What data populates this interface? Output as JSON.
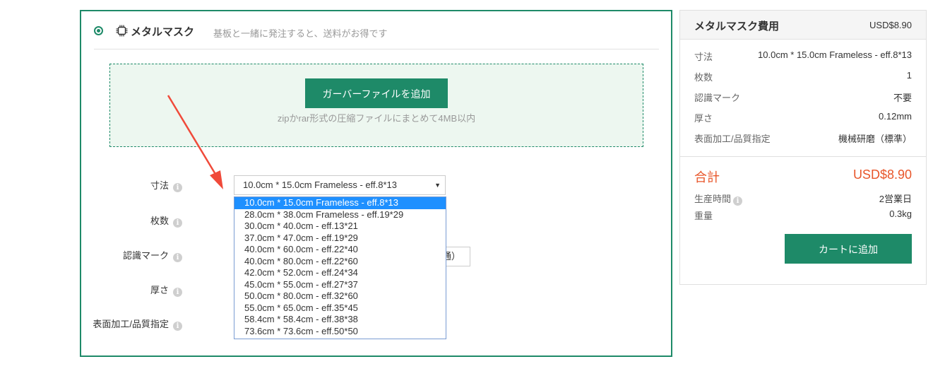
{
  "stencil": {
    "title": "メタルマスク",
    "subtitle": "基板と一緒に発注すると、送料がお得です",
    "upload_button": "ガーバーファイルを追加",
    "upload_hint": "zipかrar形式の圧縮ファイルにまとめて4MB以内",
    "labels": {
      "size": "寸法",
      "quantity": "枚数",
      "fiducial": "認識マーク",
      "thickness": "厚さ",
      "finish": "表面加工/品質指定"
    },
    "info_glyph": "i",
    "size_select": {
      "value": "10.0cm * 15.0cm Frameless - eff.8*13",
      "arrow": "▼",
      "options": [
        "10.0cm * 15.0cm Frameless - eff.8*13",
        "28.0cm * 38.0cm Frameless - eff.19*29",
        "30.0cm * 40.0cm - eff.13*21",
        "37.0cm * 47.0cm - eff.19*29",
        "40.0cm * 60.0cm - eff.22*40",
        "40.0cm * 80.0cm - eff.22*60",
        "42.0cm * 52.0cm - eff.24*34",
        "45.0cm * 55.0cm - eff.27*37",
        "50.0cm * 80.0cm - eff.32*60",
        "55.0cm * 65.0cm - eff.35*45",
        "58.4cm * 58.4cm - eff.38*38",
        "73.6cm * 73.6cm - eff.50*50"
      ]
    },
    "partial_field_text": "通）"
  },
  "summary": {
    "title": "メタルマスク費用",
    "price": "USD$8.90",
    "rows": [
      {
        "key": "寸法",
        "value": "10.0cm * 15.0cm Frameless - eff.8*13"
      },
      {
        "key": "枚数",
        "value": "1"
      },
      {
        "key": "認識マーク",
        "value": "不要"
      },
      {
        "key": "厚さ",
        "value": "0.12mm"
      },
      {
        "key": "表面加工/品質指定",
        "value": "機械研磨（標準）"
      }
    ],
    "total_label": "合計",
    "total_value": "USD$8.90",
    "production_time_label": "生産時間",
    "production_time_value": "2営業日",
    "weight_label": "重量",
    "weight_value": "0.3kg",
    "cart_button": "カートに追加"
  },
  "colors": {
    "accent": "#1e8a68",
    "total": "#e8562a",
    "selected_option": "#1e90ff",
    "annotation_arrow": "#f04a3a"
  }
}
